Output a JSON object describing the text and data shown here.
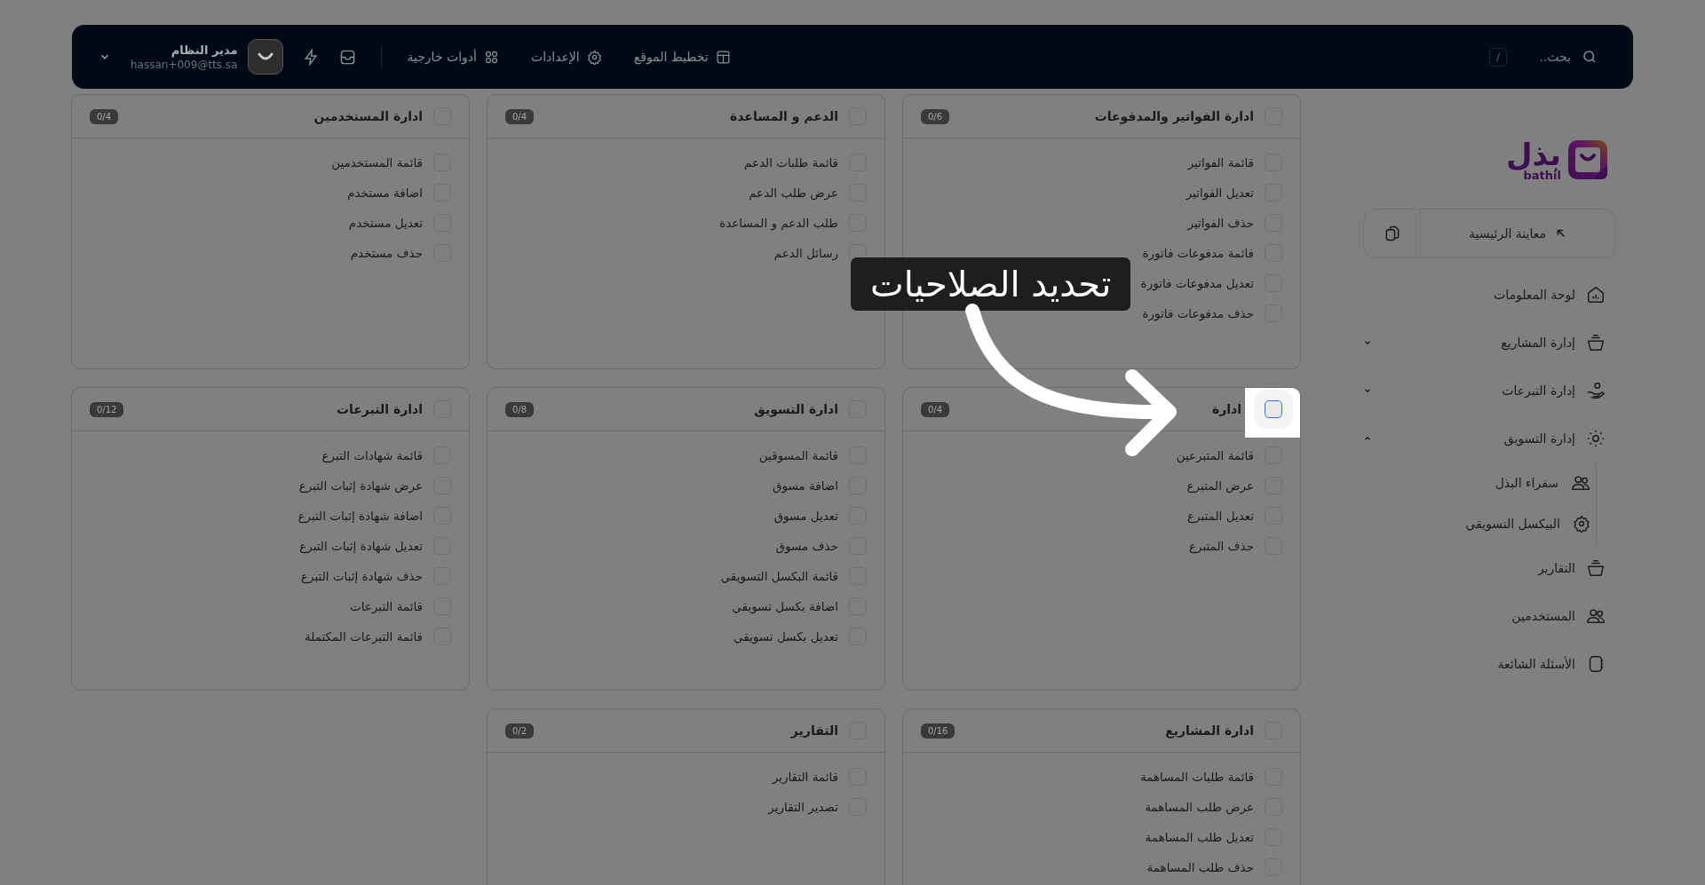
{
  "topbar": {
    "search": {
      "placeholder": "بحث..",
      "shortcut": "/"
    },
    "links": [
      {
        "label": "تخطيط الموقع"
      },
      {
        "label": "الإعدادات"
      },
      {
        "label": "أدوات خارجية"
      }
    ],
    "user": {
      "name": "مدير النظام",
      "email": "hassan+009@tts.sa"
    }
  },
  "sidebar": {
    "logo": {
      "text": "بذل",
      "latin": "bathil"
    },
    "preview_button": "معاينة الرئيسية",
    "items": [
      {
        "label": "لوحة المعلومات"
      },
      {
        "label": "إدارة المشاريع",
        "expanded": false
      },
      {
        "label": "إدارة التبرعات",
        "expanded": false
      },
      {
        "label": "إدارة التسويق",
        "expanded": true,
        "children": [
          {
            "label": "سفراء البذل"
          },
          {
            "label": "البيكسل التسويقي"
          }
        ]
      },
      {
        "label": "التقارير"
      },
      {
        "label": "المستخدمين"
      },
      {
        "label": "الأسئلة الشائعة"
      }
    ]
  },
  "permission_groups": [
    {
      "title": "ادارة الفواتير والمدفوعات",
      "count": "0/6",
      "checked": false,
      "spotlight": false,
      "permissions": [
        {
          "label": "قائمة الفواتير",
          "checked": false
        },
        {
          "label": "تعديل الفواتير",
          "checked": false
        },
        {
          "label": "حذف الفواتير",
          "checked": false
        },
        {
          "label": "قائمة مدفوعات فاتورة",
          "checked": false
        },
        {
          "label": "تعديل مدفوعات فاتورة",
          "checked": false
        },
        {
          "label": "حذف مدفوعات فاتورة",
          "checked": false
        }
      ]
    },
    {
      "title": "الدعم و المساعدة",
      "count": "0/4",
      "checked": false,
      "spotlight": false,
      "permissions": [
        {
          "label": "قائمة طلبات الدعم",
          "checked": false
        },
        {
          "label": "عرض طلب الدعم",
          "checked": false
        },
        {
          "label": "طلب الدعم و المساعدة",
          "checked": false
        },
        {
          "label": "رسائل الدعم",
          "checked": false
        }
      ]
    },
    {
      "title": "ادارة المستخدمين",
      "count": "0/4",
      "checked": false,
      "spotlight": false,
      "permissions": [
        {
          "label": "قائمة المستخدمين",
          "checked": false
        },
        {
          "label": "اضافة مستخدم",
          "checked": false
        },
        {
          "label": "تعديل مستخدم",
          "checked": false
        },
        {
          "label": "حذف مستخدم",
          "checked": false
        }
      ]
    },
    {
      "title": "ادارة",
      "count": "0/4",
      "checked": false,
      "spotlight": true,
      "permissions": [
        {
          "label": "قائمة المتبرعين",
          "checked": false
        },
        {
          "label": "عرض المتبرع",
          "checked": false
        },
        {
          "label": "تعديل المتبرع",
          "checked": false
        },
        {
          "label": "حذف المتبرع",
          "checked": false
        }
      ]
    },
    {
      "title": "ادارة التسويق",
      "count": "0/8",
      "checked": false,
      "spotlight": false,
      "permissions": [
        {
          "label": "قائمة المسوقين",
          "checked": false
        },
        {
          "label": "اضافة مسوق",
          "checked": false
        },
        {
          "label": "تعديل مسوق",
          "checked": false
        },
        {
          "label": "حذف مسوق",
          "checked": false
        },
        {
          "label": "قائمة البكسل التسويقي",
          "checked": false
        },
        {
          "label": "اضافة بكسل تسويقي",
          "checked": false
        },
        {
          "label": "تعديل بكسل تسويقي",
          "checked": false
        }
      ]
    },
    {
      "title": "ادارة التبرعات",
      "count": "0/12",
      "checked": false,
      "spotlight": false,
      "permissions": [
        {
          "label": "قائمة شهادات التبرع",
          "checked": false
        },
        {
          "label": "عرض شهادة إثبات التبرع",
          "checked": false
        },
        {
          "label": "اضافة شهادة إثبات التبرع",
          "checked": false
        },
        {
          "label": "تعديل شهادة إثبات التبرع",
          "checked": false
        },
        {
          "label": "حذف شهادة إثبات التبرع",
          "checked": false
        },
        {
          "label": "قائمة التبرعات",
          "checked": false
        },
        {
          "label": "قائمة التبرعات المكتملة",
          "checked": false
        }
      ]
    },
    {
      "title": "ادارة المشاريع",
      "count": "0/16",
      "checked": false,
      "spotlight": false,
      "permissions": [
        {
          "label": "قائمة طلبات المساهمة",
          "checked": false
        },
        {
          "label": "عرض طلب المساهمة",
          "checked": false
        },
        {
          "label": "تعديل طلب المساهمة",
          "checked": false
        },
        {
          "label": "حذف طلب المساهمة",
          "checked": false
        }
      ]
    },
    {
      "title": "التقارير",
      "count": "0/2",
      "checked": false,
      "spotlight": false,
      "permissions": [
        {
          "label": "قائمة التقارير",
          "checked": false
        },
        {
          "label": "تصدير التقارير",
          "checked": false
        }
      ]
    }
  ],
  "tour": {
    "title": "تحديد الصلاحيات"
  }
}
